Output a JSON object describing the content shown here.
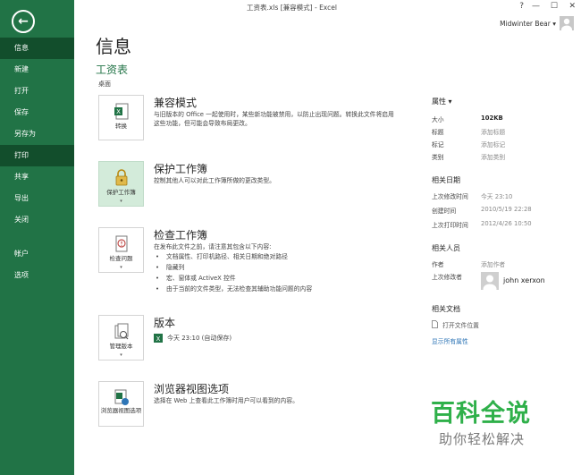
{
  "window": {
    "title": "工资表.xls  [兼容模式] - Excel",
    "controls": [
      "?",
      "—",
      "☐",
      "✕"
    ],
    "account_name": "Midwinter Bear ▾"
  },
  "sidebar": {
    "back": "←",
    "items": [
      {
        "label": "信息",
        "active": true
      },
      {
        "label": "新建"
      },
      {
        "label": "打开"
      },
      {
        "label": "保存"
      },
      {
        "label": "另存为"
      },
      {
        "label": "打印",
        "active": true
      },
      {
        "label": "共享"
      },
      {
        "label": "导出"
      },
      {
        "label": "关闭"
      },
      {
        "label": "帐户"
      },
      {
        "label": "选项"
      }
    ]
  },
  "main": {
    "title": "信息",
    "doc_name": "工资表",
    "doc_location": "桌面",
    "sections": [
      {
        "button": "转换",
        "title": "兼容模式",
        "desc": "与旧版本的 Office 一起使用时，某些新功能被禁用，以防止出现问题。转换此文件将启用这些功能，但可能会导致布局更改。",
        "icon": "excel-convert-icon"
      },
      {
        "button": "保护工作簿",
        "title": "保护工作簿",
        "desc": "控制其他人可以对此工作簿所做的更改类型。",
        "icon": "lock-key-icon"
      },
      {
        "button": "检查问题",
        "title": "检查工作簿",
        "desc": "在发布此文件之前，请注意其包含以下内容:",
        "bullets": [
          "文档属性、打印机路径、相关日期和绝对路径",
          "隐藏列",
          "宏、窗体或 ActiveX 控件",
          "由于当前的文件类型，无法检查其辅助功能问题的内容"
        ],
        "icon": "inspect-icon"
      },
      {
        "button": "管理版本",
        "title": "版本",
        "version_entry": "今天 23:10 (自动保存)",
        "icon": "manage-versions-icon"
      },
      {
        "button": "浏览器视图选项",
        "title": "浏览器视图选项",
        "desc": "选择在 Web 上查看此工作簿时用户可以看到的内容。",
        "icon": "browser-view-icon"
      }
    ]
  },
  "properties": {
    "header": "属性 ▾",
    "rows": [
      {
        "key": "大小",
        "value": "102KB"
      },
      {
        "key": "标题",
        "value": "添加标题"
      },
      {
        "key": "标记",
        "value": "添加标记"
      },
      {
        "key": "类别",
        "value": "添加类别"
      }
    ],
    "dates_header": "相关日期",
    "dates": [
      {
        "key": "上次修改时间",
        "value": "今天 23:10"
      },
      {
        "key": "创建时间",
        "value": "2010/5/19 22:28"
      },
      {
        "key": "上次打印时间",
        "value": "2012/4/26 10:50"
      }
    ],
    "people_header": "相关人员",
    "author_key": "作者",
    "author_value": "添加作者",
    "last_modified_by_key": "上次修改者",
    "last_modified_by": "john xerxon",
    "docs_header": "相关文档",
    "open_location": "打开文件位置",
    "show_all": "显示所有属性"
  },
  "watermark": {
    "title": "百科全说",
    "subtitle": "助你轻松解决"
  },
  "colors": {
    "sidebar": "#217346",
    "active": "#124e2c",
    "link": "#2e75b6",
    "watermark": "#2fb04a"
  }
}
